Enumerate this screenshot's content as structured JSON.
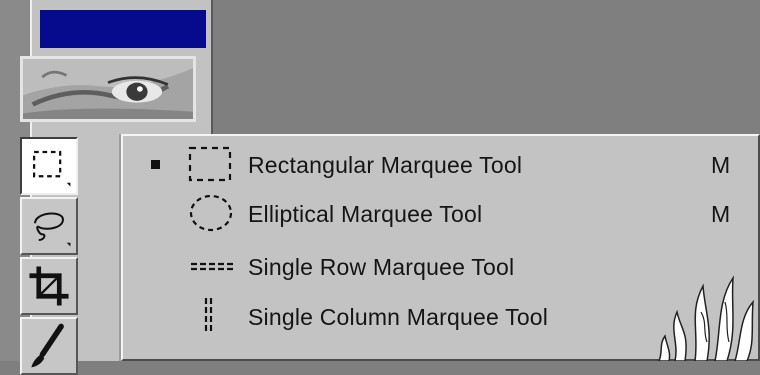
{
  "toolbox": {
    "titlebar_color": "#060a8c",
    "tools": [
      {
        "name": "rectangular-marquee",
        "icon": "rectangular-marquee-icon",
        "pressed": true
      },
      {
        "name": "lasso",
        "icon": "lasso-icon",
        "pressed": false
      },
      {
        "name": "crop",
        "icon": "crop-icon",
        "pressed": false
      },
      {
        "name": "brush",
        "icon": "brush-icon",
        "pressed": false
      }
    ]
  },
  "flyout": {
    "items": [
      {
        "label": "Rectangular Marquee Tool",
        "shortcut": "M",
        "checked": true,
        "icon": "rectangular-marquee-icon"
      },
      {
        "label": "Elliptical Marquee Tool",
        "shortcut": "M",
        "checked": false,
        "icon": "elliptical-marquee-icon"
      },
      {
        "label": "Single Row Marquee Tool",
        "shortcut": "",
        "checked": false,
        "icon": "single-row-marquee-icon"
      },
      {
        "label": "Single Column Marquee Tool",
        "shortcut": "",
        "checked": false,
        "icon": "single-column-marquee-icon"
      }
    ]
  }
}
